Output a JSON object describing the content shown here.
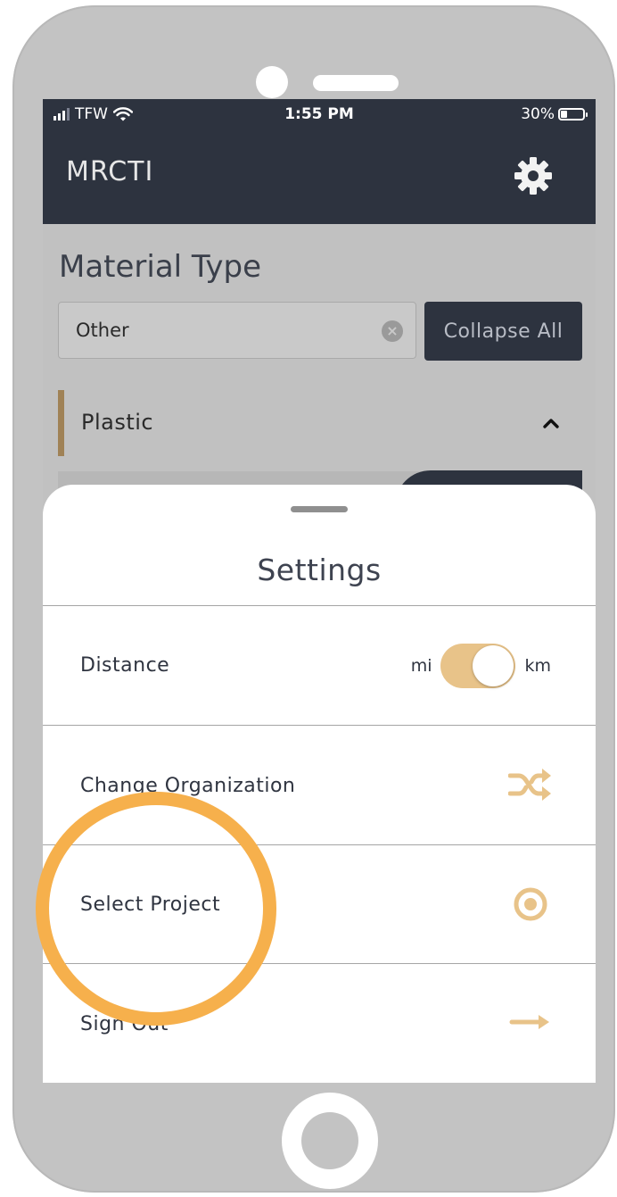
{
  "status_bar": {
    "carrier": "TFW",
    "time": "1:55 PM",
    "battery": "30%",
    "battery_level": 0.3
  },
  "app_bar": {
    "title": "MRCTI",
    "settings_icon": "gear-icon"
  },
  "filters": {
    "section_title": "Material Type",
    "input_value": "Other",
    "clear_icon": "clear-icon",
    "collapse_label": "Collapse All"
  },
  "categories": [
    {
      "label": "Plastic",
      "expanded": true,
      "accent_color": "#a08256"
    }
  ],
  "settings_sheet": {
    "title": "Settings",
    "rows": [
      {
        "label": "Distance",
        "left_option": "mi",
        "right_option": "km",
        "selected": "km"
      },
      {
        "label": "Change Organization",
        "icon": "shuffle-icon"
      },
      {
        "label": "Select Project",
        "icon": "target-icon"
      },
      {
        "label": "Sign Out",
        "icon": "arrow-right-icon"
      }
    ]
  },
  "colors": {
    "app_bar": "#2d333f",
    "accent": "#e8c389",
    "highlight": "#f6b04c",
    "phone_frame": "#c3c3c3"
  }
}
